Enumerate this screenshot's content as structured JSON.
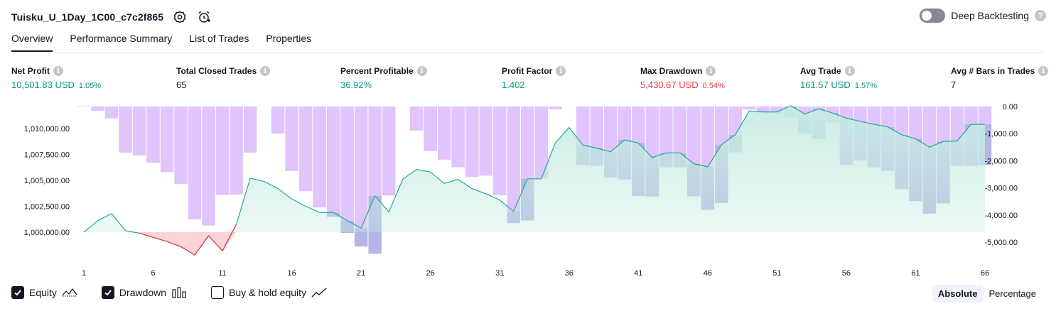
{
  "header": {
    "title": "Tuisku_U_1Day_1C00_c7c2f865",
    "icons": [
      "settings-icon",
      "alarm-add-icon"
    ],
    "deep_backtesting_label": "Deep Backtesting",
    "deep_backtesting_enabled": false
  },
  "tabs": [
    {
      "label": "Overview",
      "active": true
    },
    {
      "label": "Performance Summary",
      "active": false
    },
    {
      "label": "List of Trades",
      "active": false
    },
    {
      "label": "Properties",
      "active": false
    }
  ],
  "metrics": [
    {
      "label": "Net Profit",
      "value": "10,501.83 USD",
      "pct": "1.05%",
      "tone": "pos"
    },
    {
      "label": "Total Closed Trades",
      "value": "65",
      "pct": "",
      "tone": ""
    },
    {
      "label": "Percent Profitable",
      "value": "36.92%",
      "pct": "",
      "tone": "pos"
    },
    {
      "label": "Profit Factor",
      "value": "1.402",
      "pct": "",
      "tone": "pos"
    },
    {
      "label": "Max Drawdown",
      "value": "5,430.67 USD",
      "pct": "0.54%",
      "tone": "neg"
    },
    {
      "label": "Avg Trade",
      "value": "161.57 USD",
      "pct": "1.57%",
      "tone": "pos"
    },
    {
      "label": "Avg # Bars in Trades",
      "value": "7",
      "pct": "",
      "tone": ""
    }
  ],
  "legend": {
    "equity_label": "Equity",
    "equity_checked": true,
    "drawdown_label": "Drawdown",
    "drawdown_checked": true,
    "buyhold_label": "Buy & hold equity",
    "buyhold_checked": false
  },
  "modes": {
    "absolute": "Absolute",
    "percentage": "Percentage",
    "active": "absolute"
  },
  "colors": {
    "equity_line": "#22ab94",
    "equity_fill": "#c9ece3",
    "equity_loss": "#f23645",
    "drawdown_bar": "#e1c4fb",
    "overlap_bar": "#b3b6e6",
    "positive": "#089981",
    "negative": "#f23645"
  },
  "chart_data": {
    "type": "area",
    "x": [
      1,
      2,
      3,
      4,
      5,
      6,
      7,
      8,
      9,
      10,
      11,
      12,
      13,
      14,
      15,
      16,
      17,
      18,
      19,
      20,
      21,
      22,
      23,
      24,
      25,
      26,
      27,
      28,
      29,
      30,
      31,
      32,
      33,
      34,
      35,
      36,
      37,
      38,
      39,
      40,
      41,
      42,
      43,
      44,
      45,
      46,
      47,
      48,
      49,
      50,
      51,
      52,
      53,
      54,
      55,
      56,
      57,
      58,
      59,
      60,
      61,
      62,
      63,
      64,
      65,
      66
    ],
    "x_ticks": [
      1,
      6,
      11,
      16,
      21,
      26,
      31,
      36,
      41,
      46,
      51,
      56,
      61,
      66
    ],
    "series": [
      {
        "name": "Equity",
        "axis": "left",
        "values": [
          1000000,
          1001100,
          1001800,
          1000150,
          999900,
          999500,
          999100,
          998600,
          997800,
          999650,
          998200,
          1000750,
          1005200,
          1004900,
          1004200,
          1003200,
          1002500,
          1001900,
          1001900,
          1001100,
          1000400,
          1003500,
          1001950,
          1005100,
          1006050,
          1005800,
          1004700,
          1005100,
          1004200,
          1003700,
          1003100,
          1002000,
          1005150,
          1005150,
          1008600,
          1010100,
          1008400,
          1008100,
          1007750,
          1008900,
          1008600,
          1007200,
          1007650,
          1007650,
          1006600,
          1006300,
          1008450,
          1009400,
          1011700,
          1011600,
          1011600,
          1012200,
          1011400,
          1011900,
          1011500,
          1011000,
          1010700,
          1010400,
          1010150,
          1009400,
          1009000,
          1008200,
          1008750,
          1008800,
          1010400,
          1010400
        ]
      },
      {
        "name": "Drawdown",
        "axis": "right",
        "values": [
          -20,
          -160,
          -440,
          -1700,
          -1800,
          -2080,
          -2420,
          -2860,
          -4160,
          -4390,
          -3260,
          -3250,
          -1700,
          0,
          -1000,
          -2380,
          -3120,
          -3720,
          -4070,
          -4660,
          -5160,
          -5430,
          -3280,
          0,
          -890,
          -1640,
          -1960,
          -2240,
          -2600,
          -2550,
          -3270,
          -4300,
          -4200,
          -2650,
          -100,
          0,
          -2150,
          -2180,
          -2620,
          -2690,
          -3300,
          -3320,
          -2240,
          -2240,
          -3310,
          -3810,
          -3560,
          -1690,
          -110,
          -260,
          -260,
          -400,
          -1000,
          -1200,
          -580,
          -2150,
          -1990,
          -2240,
          -2370,
          -3050,
          -3490,
          -3950,
          -3570,
          -2180,
          -2180,
          -2150
        ]
      }
    ],
    "left_ticks": [
      1000000,
      1002500,
      1005000,
      1007500,
      1010000
    ],
    "left_tick_labels": [
      "1,000,000.00",
      "1,002,500.00",
      "1,005,000.00",
      "1,007,500.00",
      "1,010,000.00"
    ],
    "right_ticks": [
      0,
      -1000,
      -2000,
      -3000,
      -4000,
      -5000
    ],
    "right_tick_labels": [
      "0.00",
      "-1,000.00",
      "-2,000.00",
      "-3,000.00",
      "-4,000.00",
      "-5,000.00"
    ],
    "ylim_left": [
      1000000,
      1012200
    ],
    "ylim_right": [
      -5430,
      0
    ]
  }
}
